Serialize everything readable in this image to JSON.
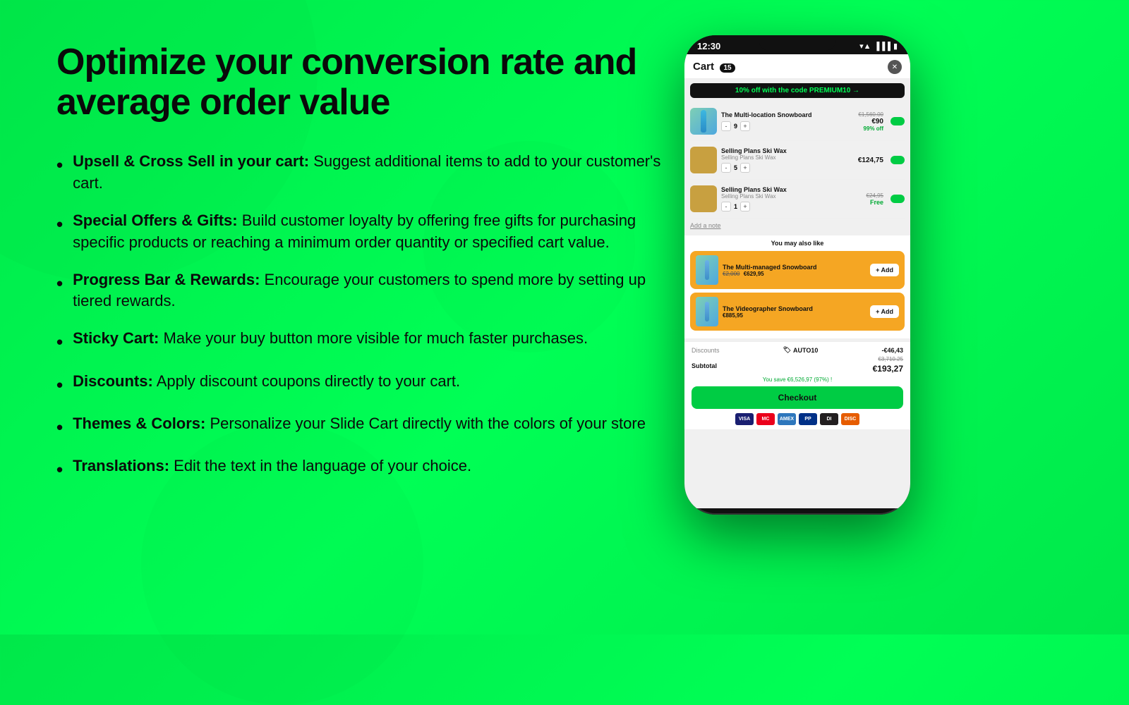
{
  "background": {
    "color": "#00e84a"
  },
  "headline": {
    "line1": "Optimize your conversion rate and",
    "line2": "average order value"
  },
  "features": [
    {
      "id": "upsell",
      "bold": "Upsell & Cross Sell in your cart:",
      "text": " Suggest additional items to add to your customer's cart."
    },
    {
      "id": "gifts",
      "bold": "Special Offers & Gifts:",
      "text": " Build customer loyalty by offering free gifts for purchasing specific products or reaching a minimum order quantity or specified cart value."
    },
    {
      "id": "progress",
      "bold": "Progress Bar & Rewards:",
      "text": " Encourage your customers to spend more by setting up tiered rewards."
    },
    {
      "id": "sticky",
      "bold": "Sticky Cart:",
      "text": " Make your buy button more visible for much faster purchases."
    },
    {
      "id": "discounts",
      "bold": "Discounts:",
      "text": " Apply discount coupons directly to your cart."
    },
    {
      "id": "themes",
      "bold": "Themes & Colors:",
      "text": " Personalize your Slide Cart directly with the colors of your store"
    },
    {
      "id": "translations",
      "bold": "Translations:",
      "text": " Edit the text in the language of your choice."
    }
  ],
  "phone": {
    "time": "12:30",
    "cart_title": "Cart",
    "cart_count": "15",
    "promo": "10% off with the code PREMIUM10 →",
    "items": [
      {
        "name": "The Multi-location Snowboard",
        "type": "ski",
        "qty": "9",
        "price_old": "€1,560.00",
        "price_new": "€90",
        "discount": "99% off",
        "has_toggle": true
      },
      {
        "name": "Selling Plans Ski Wax",
        "sub": "Selling Plans Ski Wax",
        "type": "wax",
        "qty": "5",
        "price": "€124,75",
        "has_toggle": true
      },
      {
        "name": "Selling Plans Ski Wax",
        "sub": "Selling Plans Ski Wax",
        "type": "wax",
        "qty": "1",
        "price_old": "€24,95",
        "price_free": "Free",
        "has_toggle": true
      }
    ],
    "add_note": "Add a note",
    "upsell_title": "You may also like",
    "upsell_items": [
      {
        "name": "The Multi-managed Snowboard",
        "price_old": "€2,000",
        "price_new": "€629,95",
        "add_label": "+ Add"
      },
      {
        "name": "The Videographer Snowboard",
        "price": "€885,95",
        "add_label": "+ Add"
      }
    ],
    "discount_label": "Discounts",
    "discount_code": "AUTO10",
    "discount_value": "-€46,43",
    "subtotal_label": "Subtotal",
    "subtotal_old": "€3,710.25",
    "subtotal_new": "€193,27",
    "savings": "You save €6,526,97 (97%) !",
    "checkout_label": "Checkout",
    "payment_icons": [
      "VISA",
      "MC",
      "AMEX",
      "PP",
      "DI",
      "DISC"
    ]
  }
}
